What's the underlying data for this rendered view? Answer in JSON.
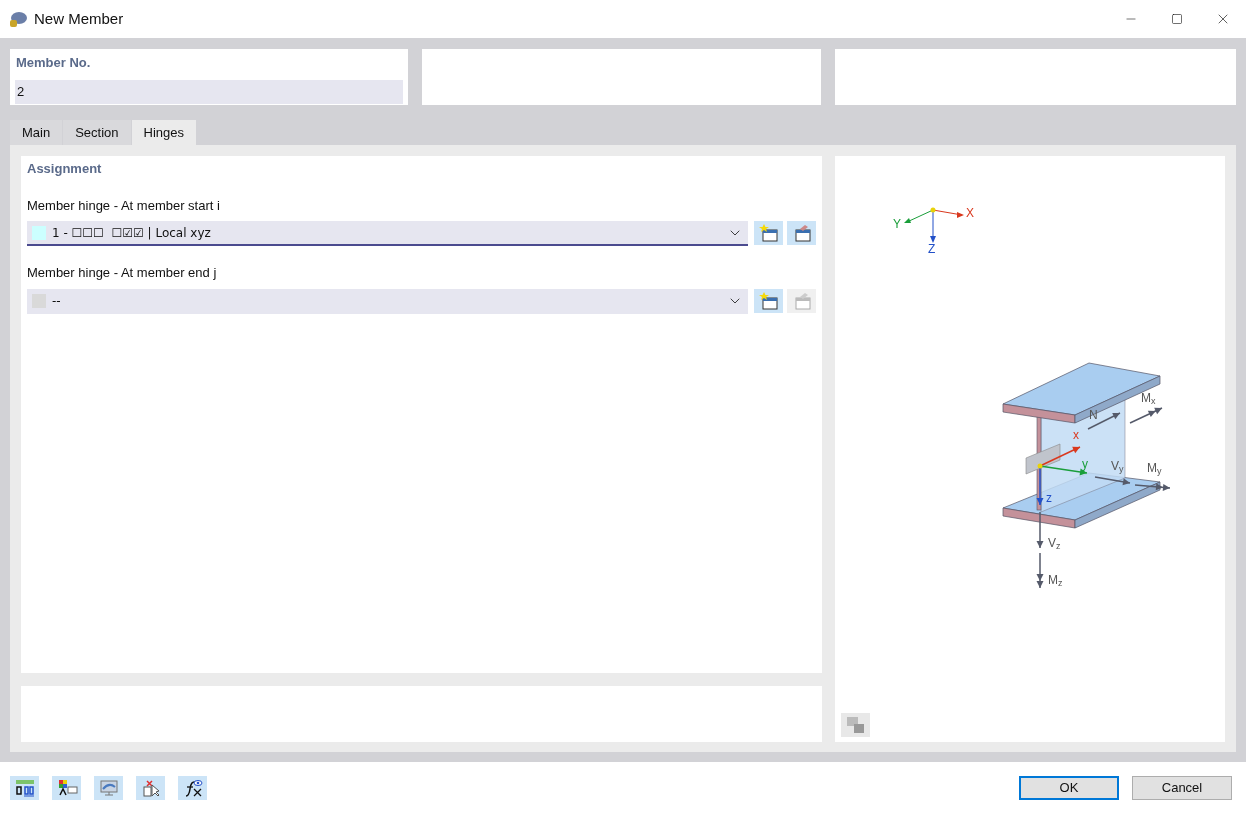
{
  "window": {
    "title": "New Member"
  },
  "header": {
    "label": "Member No.",
    "value": "2"
  },
  "tabs": [
    {
      "label": "Main",
      "selected": false
    },
    {
      "label": "Section",
      "selected": false
    },
    {
      "label": "Hinges",
      "selected": true
    }
  ],
  "assignment": {
    "title": "Assignment",
    "fields": [
      {
        "label": "Member hinge - At member start i",
        "value": "1 - ☐☐☐  ☐☑☑ | Local xyz",
        "color": "#ccffff",
        "focused": true,
        "edit_enabled": true
      },
      {
        "label": "Member hinge - At member end j",
        "value": "--",
        "color": "#d9d9d9",
        "focused": false,
        "edit_enabled": false
      }
    ]
  },
  "diagram": {
    "global_axes": [
      "X",
      "Y",
      "Z"
    ],
    "labels": [
      "N",
      "M$_{x}$",
      "x",
      "y",
      "V$_{y}$",
      "M$_{y}$",
      "z",
      "V$_{z}$",
      "M$_{z}$"
    ]
  },
  "buttons": [
    {
      "label": "OK",
      "default": true
    },
    {
      "label": "Cancel",
      "default": false
    }
  ]
}
